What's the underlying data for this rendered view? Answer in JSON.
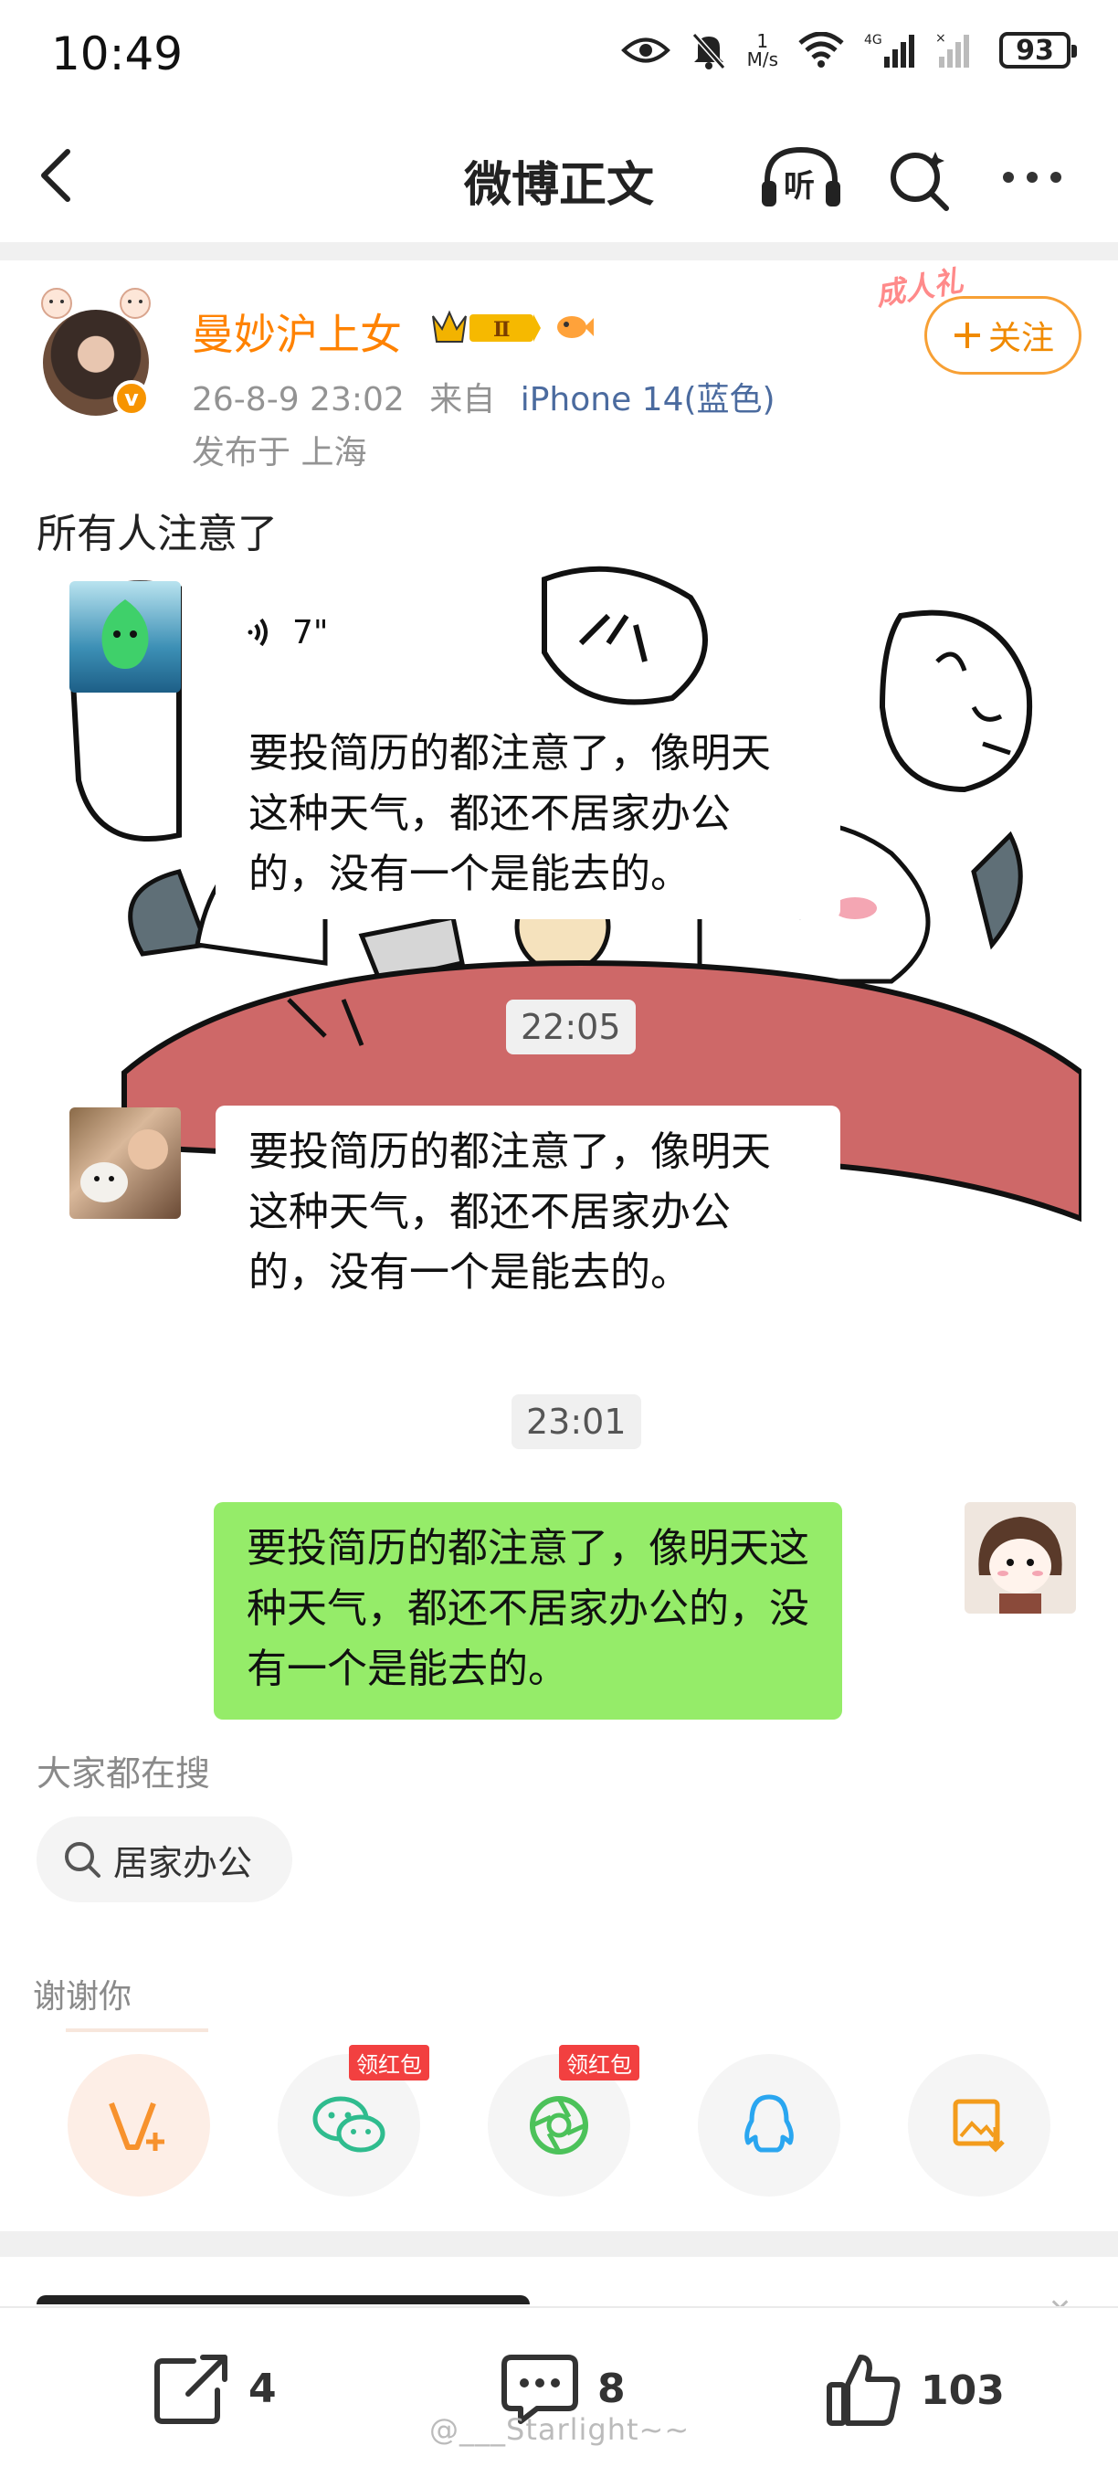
{
  "status_bar": {
    "time": "10:49",
    "net_speed_value": "1",
    "net_speed_unit": "M/s",
    "network": "4G",
    "battery": "93"
  },
  "nav": {
    "title": "微博正文",
    "listen_label": "听"
  },
  "post": {
    "author": "曼妙沪上女",
    "level": "Ⅱ",
    "date": "26-8-9 23:02",
    "source_prefix": "来自",
    "device": "iPhone 14(蓝色)",
    "location": "发布于 上海",
    "follow_tag": "成人礼",
    "follow_label": "关注",
    "text": "所有人注意了"
  },
  "chat": {
    "voice_duration": "7\"",
    "message_1": "要投简历的都注意了，像明天这种天气，都还不居家办公的，没有一个是能去的。",
    "time_1": "22:05",
    "message_2": "要投简历的都注意了，像明天这种天气，都还不居家办公的，没有一个是能去的。",
    "time_2": "23:01",
    "message_3": "要投简历的都注意了，像明天这种天气，都还不居家办公的，没有一个是能去的。"
  },
  "search_section": {
    "label": "大家都在搜",
    "chip": "居家办公"
  },
  "share_section": {
    "label": "谢谢你",
    "buttons": [
      {
        "icon": "v-plus-icon",
        "badge": ""
      },
      {
        "icon": "wechat-icon",
        "badge": "领红包"
      },
      {
        "icon": "moments-icon",
        "badge": "领红包"
      },
      {
        "icon": "qq-icon",
        "badge": ""
      },
      {
        "icon": "save-image-icon",
        "badge": ""
      }
    ]
  },
  "bottom_bar": {
    "repost_count": "4",
    "comment_count": "8",
    "like_count": "103"
  },
  "watermark": "@___Starlight~~",
  "colors": {
    "accent_orange": "#ff8200",
    "device_blue": "#4b6b9f",
    "chat_green": "#95ec69",
    "redpack_red": "#f24040"
  }
}
